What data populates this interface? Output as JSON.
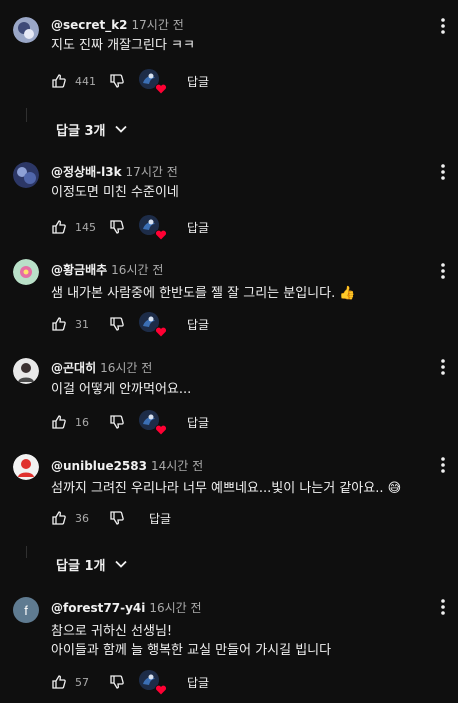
{
  "comments": [
    {
      "author": "@secret_k2",
      "time": "17시간 전",
      "lines": [
        "지도 진짜 개잘그린다 ㅋㅋ"
      ],
      "likes": "441",
      "reply_label": "답글",
      "avatar_icon": "photo-avatar-blue"
    },
    {
      "author": "@정상배-l3k",
      "time": "17시간 전",
      "lines": [
        "이정도면 미친 수준이네"
      ],
      "likes": "145",
      "reply_label": "답글",
      "avatar_icon": "photo-avatar-blue"
    },
    {
      "author": "@황금배추",
      "time": "16시간 전",
      "lines": [
        "샘 내가본 사람중에  한반도를 젤 잘 그리는 분입니다. 👍"
      ],
      "likes": "31",
      "reply_label": "답글",
      "avatar_icon": "photo-avatar-flower"
    },
    {
      "author": "@곤대히",
      "time": "16시간 전",
      "lines": [
        "이걸 어떻게 안까먹어요..."
      ],
      "likes": "16",
      "reply_label": "답글",
      "avatar_icon": "photo-avatar-person"
    },
    {
      "author": "@uniblue2583",
      "time": "14시간 전",
      "lines": [
        "섬까지 그려진 우리나라 너무 예쁘네요...빛이 나는거 같아요.. 😅"
      ],
      "likes": "36",
      "reply_label": "답글",
      "avatar_icon": "photo-avatar-red"
    },
    {
      "author": "@forest77-y4i",
      "time": "16시간 전",
      "lines": [
        "참으로 귀하신 선생님!",
        "아이들과 함께 늘 행복한 교실 만들어 가시길 빕니다"
      ],
      "likes": "57",
      "reply_label": "답글",
      "avatar_letter": "f"
    }
  ],
  "reply_toggles": [
    {
      "label": "답글 3개"
    },
    {
      "label": "답글 1개"
    }
  ],
  "colors": {
    "background": "#0f0f0f",
    "text": "#f1f1f1",
    "muted": "#aaaaaa",
    "heart": "#ff0033"
  }
}
